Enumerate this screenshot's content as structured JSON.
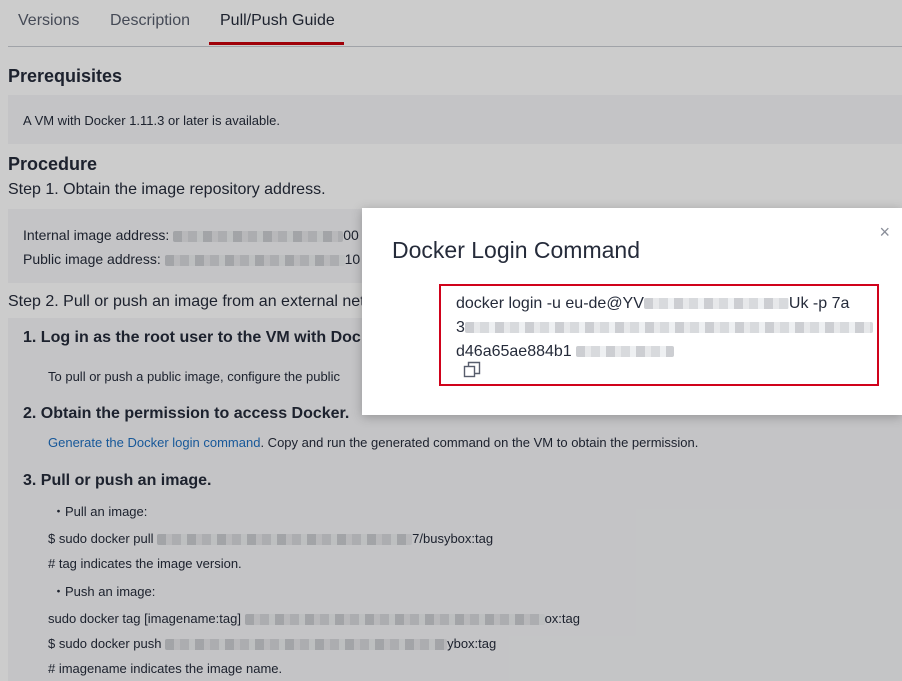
{
  "tabs": {
    "items": [
      {
        "label": "Versions"
      },
      {
        "label": "Description"
      },
      {
        "label": "Pull/Push Guide"
      }
    ],
    "active": "Pull/Push Guide"
  },
  "prerequisites": {
    "heading": "Prerequisites",
    "text": "A VM with Docker 1.11.3 or later is available."
  },
  "procedure": {
    "heading": "Procedure",
    "step1": "Step 1. Obtain the image repository address.",
    "internal_label": "Internal image address:",
    "internal_suffix": "00",
    "public_label": "Public image address:",
    "public_suffix": "10",
    "step2": "Step 2. Pull or push an image from an external net",
    "sub1_heading": "1. Log in as the root user to the VM with Doc",
    "sub1_text": "To pull or push a public image, configure the public",
    "sub2_heading": "2. Obtain the permission to access Docker.",
    "sub2_link": "Generate the Docker login command",
    "sub2_text": ". Copy and run the generated command on the VM to obtain the permission.",
    "sub3_heading": "3. Pull or push an image.",
    "pull_label": "・Pull an image:",
    "pull_cmd_prefix": "$ sudo docker pull",
    "pull_cmd_suffix": "7/busybox:tag",
    "tag_note": "# tag indicates the image version.",
    "push_label": "・Push an image:",
    "tag_cmd_prefix": "sudo docker tag [imagename:tag]",
    "tag_cmd_suffix": "ox:tag",
    "push_cmd_prefix": "$ sudo docker push",
    "push_cmd_suffix": "ybox:tag",
    "imagename_note": "# imagename indicates the image name."
  },
  "modal": {
    "title": "Docker Login Command",
    "close": "×",
    "line1_prefix": "docker login -u eu-de@YV",
    "line1_suffix": "Uk -p 7a",
    "line2_prefix": "3",
    "line3_prefix": "d46a65ae884b1"
  },
  "colors": {
    "accent": "#c7000b",
    "link": "#1e6fc0",
    "highlight_border": "#d0021b"
  }
}
